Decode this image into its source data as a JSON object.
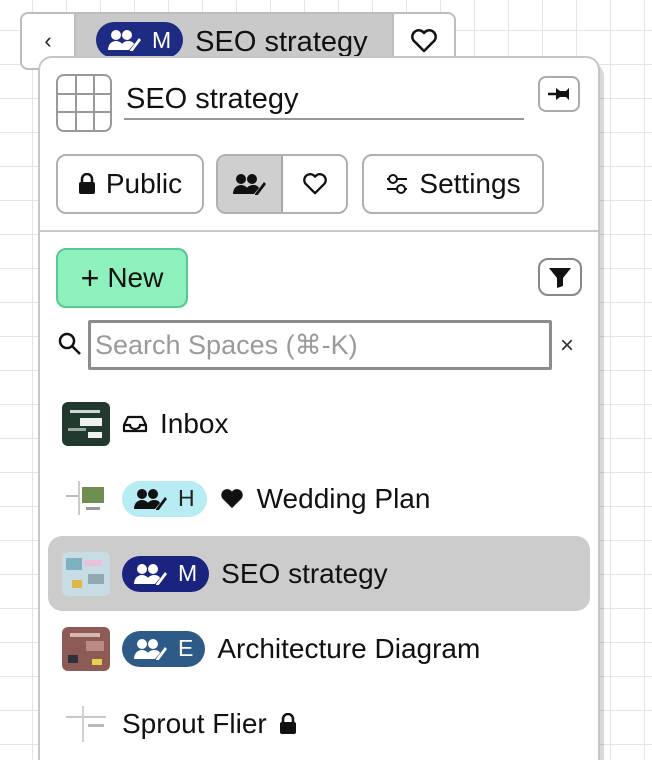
{
  "header": {
    "back_glyph": "‹",
    "badge_letter": "M",
    "title": "SEO strategy"
  },
  "panel": {
    "space_name": "SEO strategy",
    "visibility_label": "Public",
    "settings_label": "Settings",
    "new_label": "New",
    "new_glyph": "+",
    "search": {
      "placeholder": "Search Spaces (⌘-K)",
      "value": "",
      "clear_glyph": "×"
    }
  },
  "spaces": [
    {
      "name": "Inbox",
      "badge": null,
      "prefix_icon": "inbox-icon",
      "suffix_icon": null,
      "selected": false
    },
    {
      "name": "Wedding Plan",
      "badge": "H",
      "badge_color": "#b8ecf5",
      "prefix_icon": "heart-icon",
      "suffix_icon": null,
      "selected": false
    },
    {
      "name": "SEO strategy",
      "badge": "M",
      "badge_color": "#1a237e",
      "prefix_icon": null,
      "suffix_icon": null,
      "selected": true
    },
    {
      "name": "Architecture Diagram",
      "badge": "E",
      "badge_color": "#2e5a87",
      "prefix_icon": null,
      "suffix_icon": null,
      "selected": false
    },
    {
      "name": "Sprout Flier",
      "badge": null,
      "prefix_icon": null,
      "suffix_icon": "lock-icon",
      "selected": false
    }
  ],
  "colors": {
    "accent_new": "#8ef0bd",
    "selected_row": "#cccccc",
    "badge_dark": "#1a237e"
  }
}
